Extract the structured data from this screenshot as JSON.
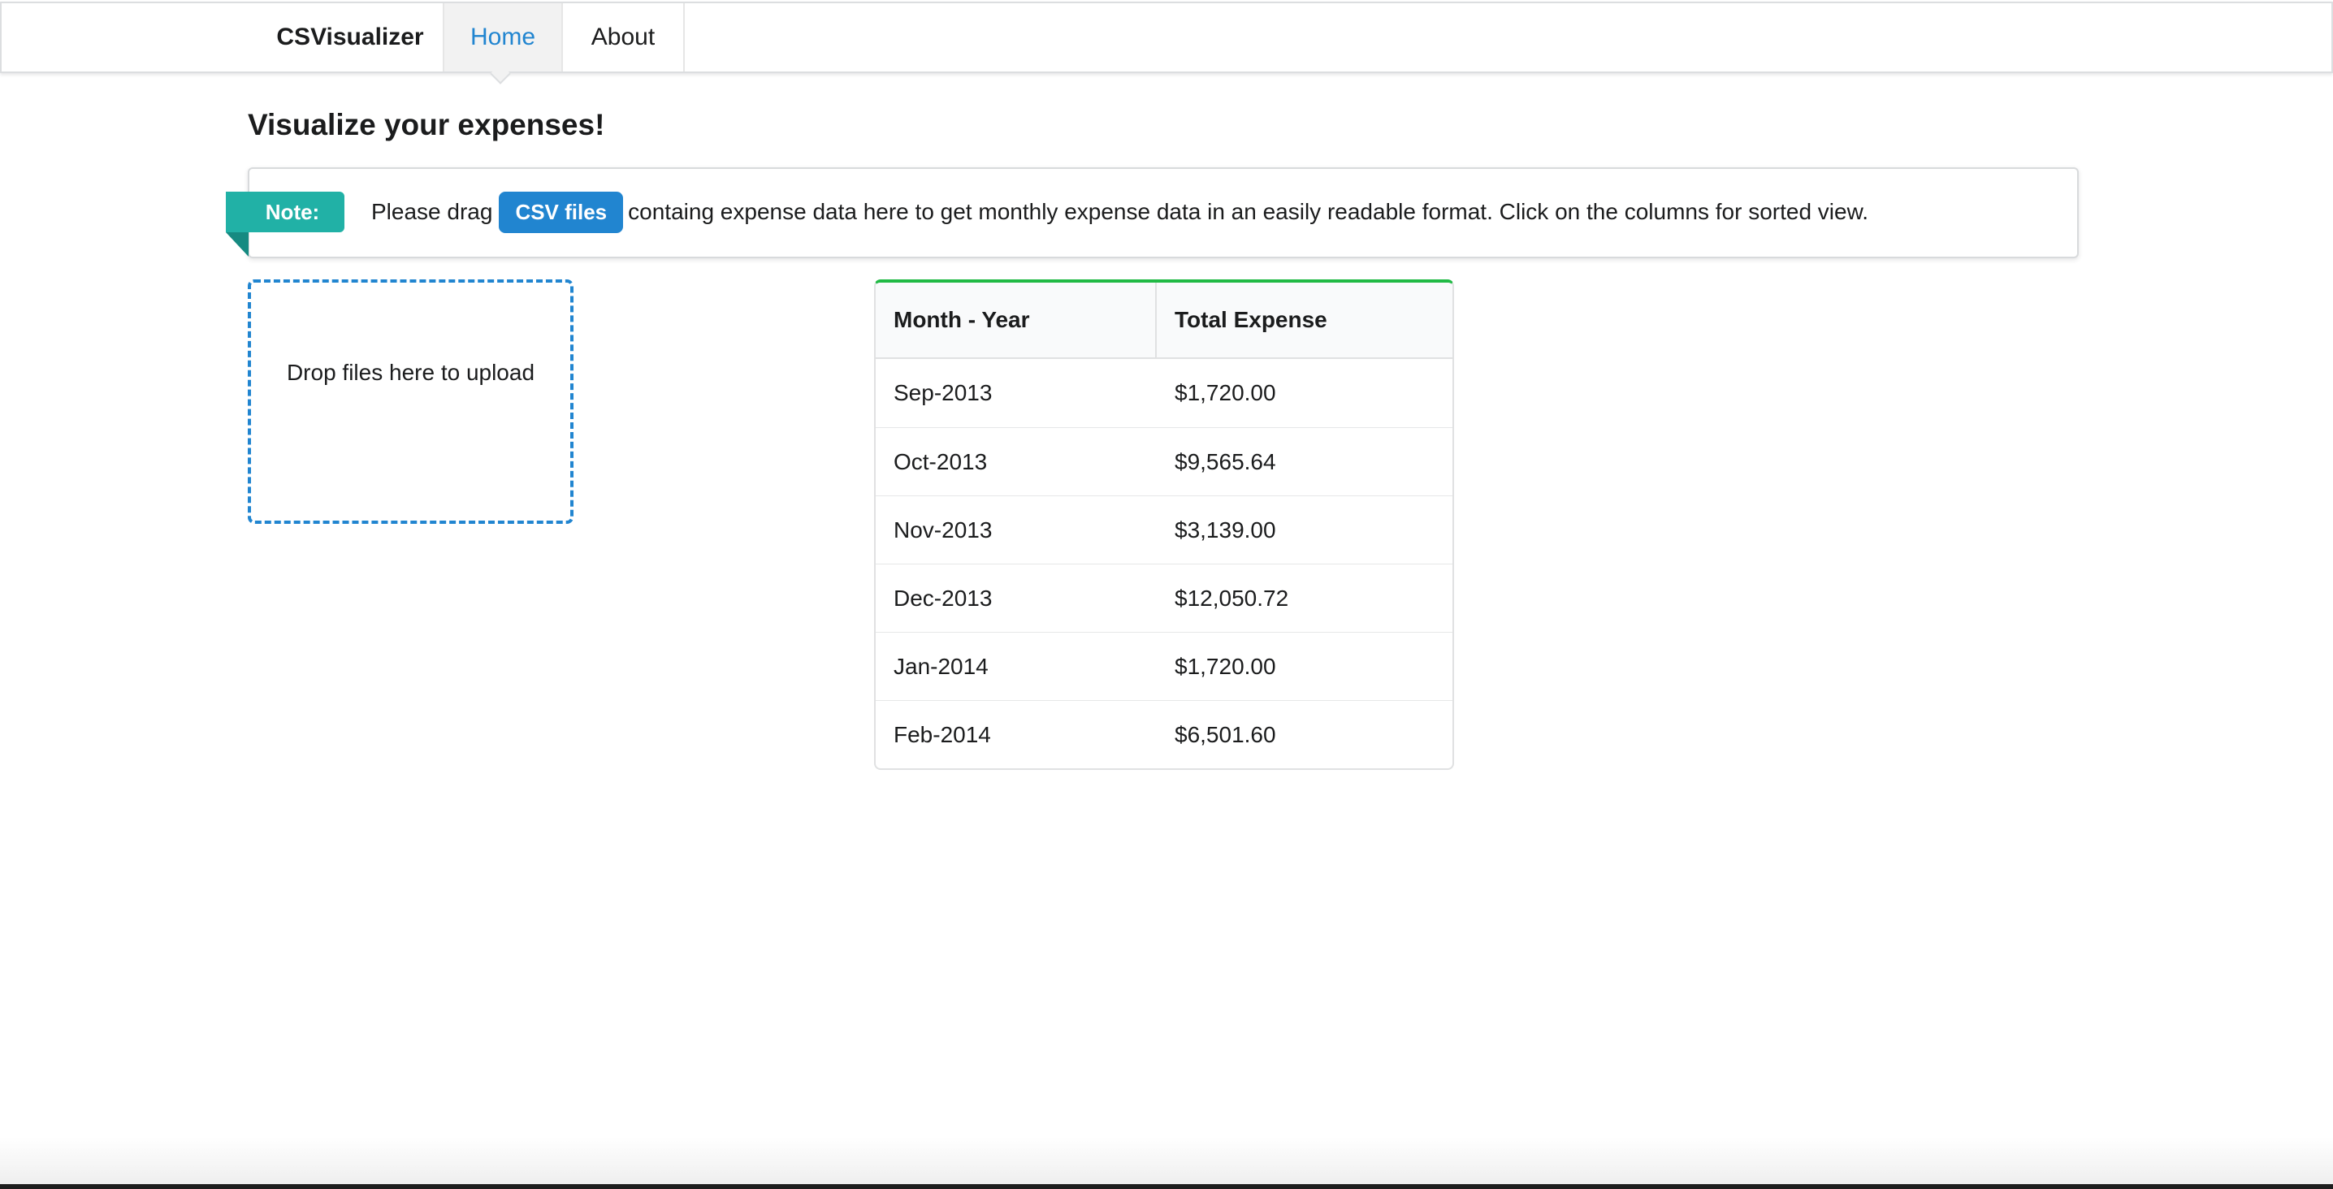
{
  "nav": {
    "brand": "CSVisualizer",
    "home": "Home",
    "about": "About"
  },
  "page_title": "Visualize your expenses!",
  "note": {
    "ribbon": "Note:",
    "text_before": "Please drag",
    "csv_label": "CSV files",
    "text_after": "containg expense data here to get monthly expense data in an easily readable format. Click on the columns for sorted view."
  },
  "dropzone": {
    "text": "Drop files here to upload"
  },
  "table": {
    "headers": [
      "Month - Year",
      "Total Expense"
    ],
    "rows": [
      [
        "Sep-2013",
        "$1,720.00"
      ],
      [
        "Oct-2013",
        "$9,565.64"
      ],
      [
        "Nov-2013",
        "$3,139.00"
      ],
      [
        "Dec-2013",
        "$12,050.72"
      ],
      [
        "Jan-2014",
        "$1,720.00"
      ],
      [
        "Feb-2014",
        "$6,501.60"
      ]
    ]
  },
  "colors": {
    "accent_blue": "#2185d0",
    "note_teal": "#21b1a6",
    "table_top_green": "#21ba45"
  }
}
